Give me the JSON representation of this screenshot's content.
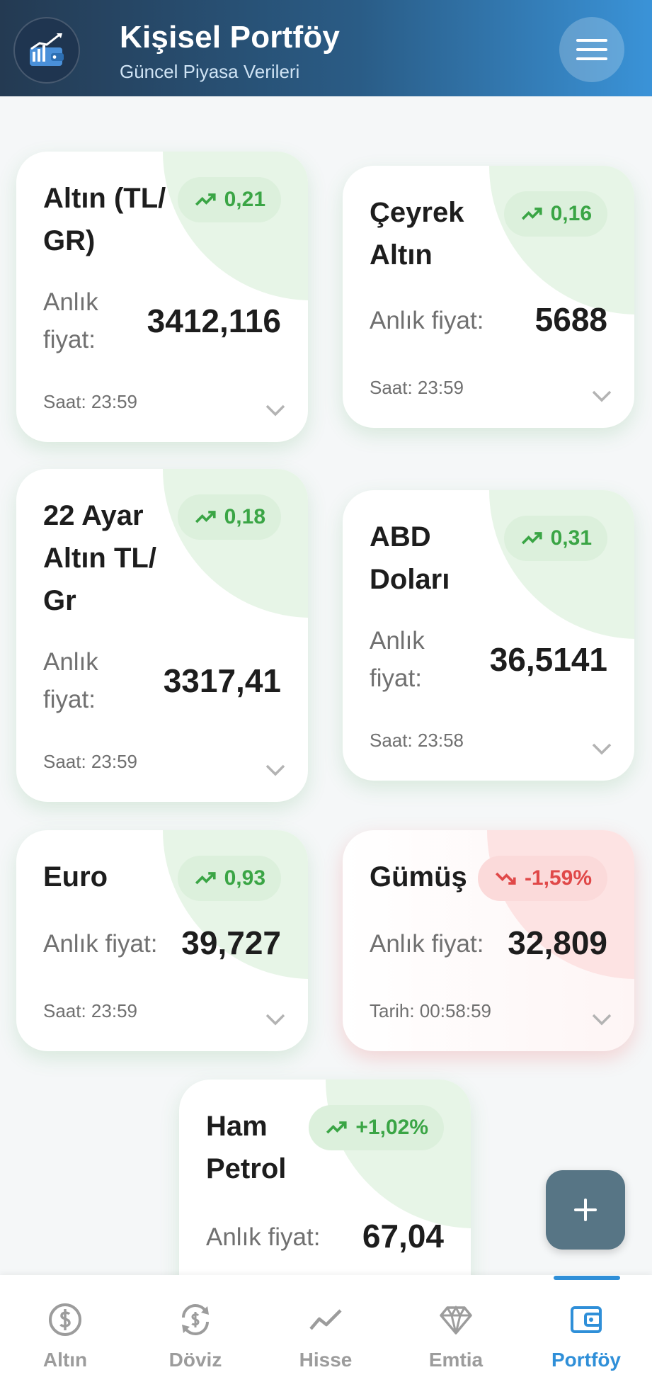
{
  "header": {
    "title": "Kişisel Portföy",
    "subtitle": "Güncel Piyasa Verileri",
    "logo_icon": "wallet-chart-icon",
    "menu_icon": "hamburger-menu-icon"
  },
  "colors": {
    "up": "#3aa545",
    "down": "#e04848",
    "accent": "#2f8fd8",
    "fab": "#577585"
  },
  "cards": [
    {
      "name": "Altın (TL/\nGR)",
      "change": "0,21",
      "direction": "up",
      "price_label": "Anlık\nfiyat:",
      "price": "3412,116",
      "time": "Saat: 23:59"
    },
    {
      "name": "Çeyrek\nAltın",
      "change": "0,16",
      "direction": "up",
      "price_label": "Anlık fiyat:",
      "price": "5688",
      "time": "Saat: 23:59"
    },
    {
      "name": "22 Ayar\nAltın TL/\nGr",
      "change": "0,18",
      "direction": "up",
      "price_label": "Anlık\nfiyat:",
      "price": "3317,41",
      "time": "Saat: 23:59"
    },
    {
      "name": "ABD\nDoları",
      "change": "0,31",
      "direction": "up",
      "price_label": "Anlık\nfiyat:",
      "price": "36,5141",
      "time": "Saat: 23:58"
    },
    {
      "name": "Euro",
      "change": "0,93",
      "direction": "up",
      "price_label": "Anlık fiyat:",
      "price": "39,727",
      "time": "Saat: 23:59"
    },
    {
      "name": "Gümüş",
      "change": "-1,59%",
      "direction": "down",
      "price_label": "Anlık fiyat:",
      "price": "32,809",
      "time": "Tarih: 00:58:59"
    },
    {
      "name": "Ham\nPetrol",
      "change": "+1,02%",
      "direction": "up",
      "price_label": "Anlık fiyat:",
      "price": "67,04",
      "time": ""
    }
  ],
  "fab": {
    "icon": "plus-icon"
  },
  "nav": [
    {
      "label": "Altın",
      "icon": "dollar-circle-icon",
      "active": false
    },
    {
      "label": "Döviz",
      "icon": "currency-exchange-icon",
      "active": false
    },
    {
      "label": "Hisse",
      "icon": "trending-line-icon",
      "active": false
    },
    {
      "label": "Emtia",
      "icon": "diamond-icon",
      "active": false
    },
    {
      "label": "Portföy",
      "icon": "wallet-icon",
      "active": true
    }
  ]
}
